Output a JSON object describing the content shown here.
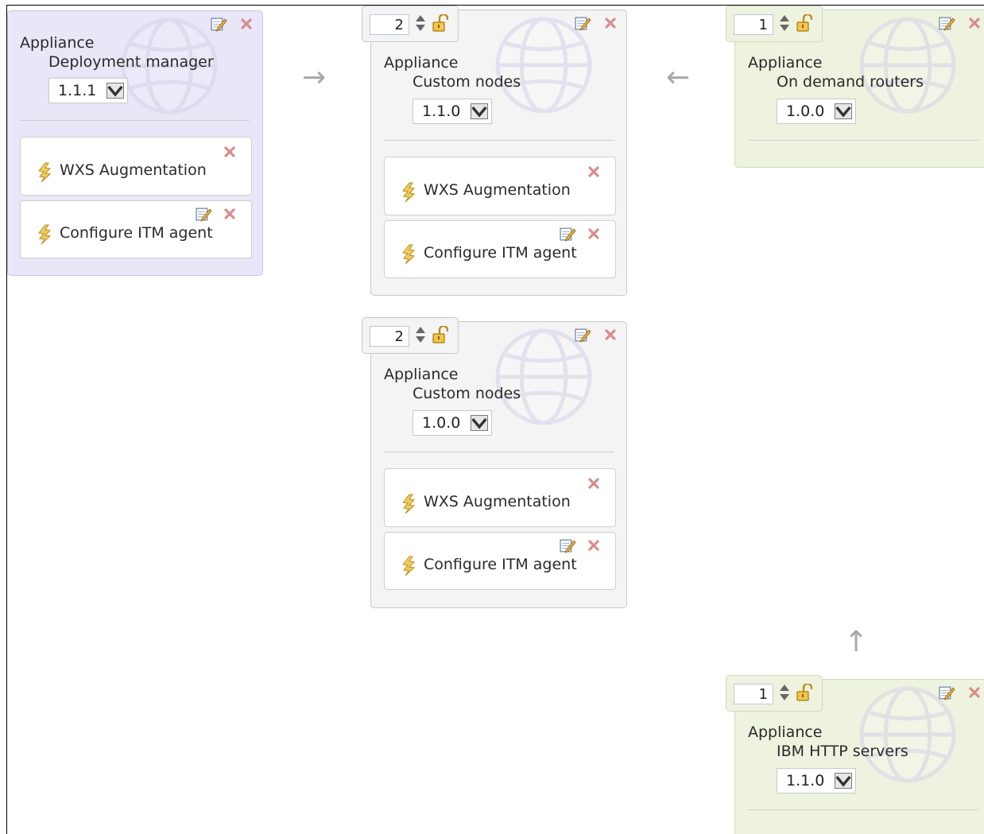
{
  "cards": [
    {
      "title": "Appliance",
      "name": "Deployment manager",
      "version": "1.1.1",
      "parts": [
        {
          "label": "WXS Augmentation",
          "editable": false
        },
        {
          "label": "Configure ITM agent",
          "editable": true
        }
      ]
    },
    {
      "instances": "2",
      "title": "Appliance",
      "name": "Custom nodes",
      "version": "1.1.0",
      "parts": [
        {
          "label": "WXS Augmentation",
          "editable": false
        },
        {
          "label": "Configure ITM agent",
          "editable": true
        }
      ]
    },
    {
      "instances": "1",
      "title": "Appliance",
      "name": "On demand routers",
      "version": "1.0.0",
      "parts": []
    },
    {
      "instances": "2",
      "title": "Appliance",
      "name": "Custom nodes",
      "version": "1.0.0",
      "parts": [
        {
          "label": "WXS Augmentation",
          "editable": false
        },
        {
          "label": "Configure ITM agent",
          "editable": true
        }
      ]
    },
    {
      "instances": "1",
      "title": "Appliance",
      "name": "IBM HTTP servers",
      "version": "1.1.0",
      "parts": []
    }
  ],
  "arrows": [
    "→",
    "←",
    "↑"
  ],
  "colors": {
    "purple_card": "#e8e6f7",
    "gray_card": "#f4f4f4",
    "green_card": "#eef3df",
    "close": "#d98c8c",
    "arrow": "#a8a8a8"
  },
  "icons": [
    "edit-icon",
    "close-icon",
    "spinner-icon",
    "lock-icon",
    "script-package-icon",
    "dropdown-arrow-icon",
    "globe-watermark-icon"
  ]
}
